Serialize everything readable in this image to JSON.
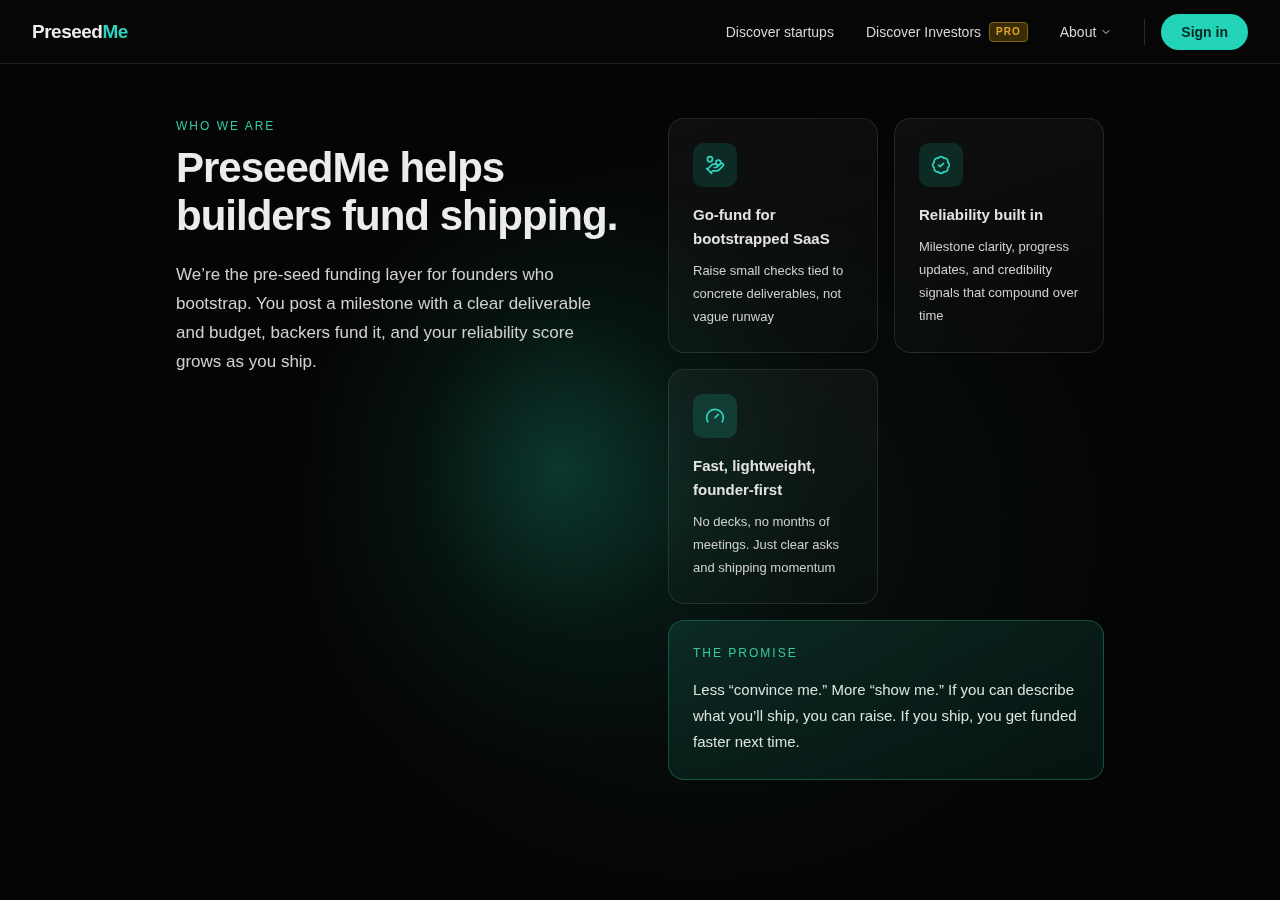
{
  "header": {
    "logo": {
      "text": "Preseed",
      "accent": "Me"
    },
    "nav": [
      {
        "kind": "link",
        "label": "Discover startups"
      },
      {
        "kind": "link",
        "label": "Discover Investors",
        "badge": "PRO"
      },
      {
        "kind": "dropdown",
        "label": "About"
      }
    ],
    "sign_in": "Sign in"
  },
  "intro": {
    "eyebrow": "WHO WE ARE",
    "title": "PreseedMe helps builders fund shipping.",
    "body": "We’re the pre-seed funding layer for founders who bootstrap. You post a milestone with a clear deliverable and budget, backers fund it, and your reliability score grows as you ship."
  },
  "features": [
    {
      "title": "Go-fund for bootstrapped SaaS",
      "description": "Raise small checks tied to concrete deliverables, not vague runway"
    },
    {
      "title": "Reliability built in",
      "description": "Milestone clarity, progress updates, and credibility signals that compound over time"
    },
    {
      "title": "Fast, lightweight, founder-first",
      "description": "No decks, no months of meetings. Just clear asks and shipping momentum"
    }
  ],
  "promise": {
    "eyebrow": "THE PROMISE",
    "text": "Less “convince me.” More “show me.” If you can describe what you’ll ship, you can raise. If you ship, you get funded faster next time."
  }
}
